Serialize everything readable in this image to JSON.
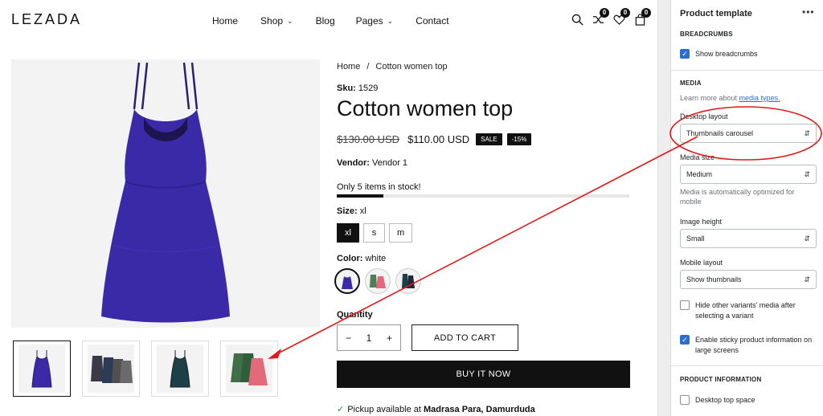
{
  "store": {
    "logo": "LEZADA",
    "nav": [
      {
        "label": "Home",
        "has_dropdown": false
      },
      {
        "label": "Shop",
        "has_dropdown": true
      },
      {
        "label": "Blog",
        "has_dropdown": false
      },
      {
        "label": "Pages",
        "has_dropdown": true
      },
      {
        "label": "Contact",
        "has_dropdown": false
      }
    ],
    "header_icons": [
      {
        "name": "search-icon"
      },
      {
        "name": "compare-icon",
        "count": "0"
      },
      {
        "name": "wishlist-icon",
        "count": "0"
      },
      {
        "name": "cart-icon",
        "count": "0"
      }
    ],
    "breadcrumb": {
      "home": "Home",
      "sep": "/",
      "current": "Cotton women top"
    },
    "sku": {
      "label": "Sku:",
      "value": "1529"
    },
    "title": "Cotton women top",
    "price": {
      "old": "$130.00 USD",
      "new": "$110.00 USD",
      "sale_tag": "SALE",
      "discount_tag": "-15%"
    },
    "vendor": {
      "label": "Vendor:",
      "value": "Vendor 1"
    },
    "stock": {
      "text": "Only 5 items in stock!",
      "level": 0.16
    },
    "size": {
      "label": "Size:",
      "value": "xl",
      "options": [
        "xl",
        "s",
        "m"
      ],
      "selected": 0
    },
    "color": {
      "label": "Color:",
      "value": "white",
      "swatch_colors": [
        "#3b2aa8",
        "#5a8a5f",
        "#1d3f48"
      ],
      "selected": 0
    },
    "quantity": {
      "label": "Quantity",
      "value": "1",
      "minus": "−",
      "plus": "+"
    },
    "add_to_cart": "ADD TO CART",
    "buy_now": "BUY IT NOW",
    "pickup": {
      "text": "Pickup available at ",
      "location": "Madrasa Para, Damurduda"
    },
    "colors": {
      "top_purple": "#3b2aa8",
      "dark": "#111111"
    }
  },
  "panel": {
    "title": "Product template",
    "more": "•••",
    "breadcrumbs_heading": "BREADCRUMBS",
    "show_breadcrumbs": {
      "label": "Show breadcrumbs",
      "checked": true
    },
    "media_heading": "MEDIA",
    "media_help_prefix": "Learn more about ",
    "media_help_link": "media types.",
    "desktop_layout": {
      "label": "Desktop layout",
      "value": "Thumbnails carousel"
    },
    "media_size": {
      "label": "Media size",
      "value": "Medium",
      "help": "Media is automatically optimized for mobile"
    },
    "image_height": {
      "label": "Image height",
      "value": "Small"
    },
    "mobile_layout": {
      "label": "Mobile layout",
      "value": "Show thumbnails"
    },
    "hide_variants": {
      "label": "Hide other variants' media after selecting a variant",
      "checked": false
    },
    "sticky_info": {
      "label": "Enable sticky product information on large screens",
      "checked": true
    },
    "product_info_heading": "PRODUCT INFORMATION",
    "desktop_top_space": {
      "label": "Desktop top space",
      "checked": false
    },
    "accent": "#2c6ecb"
  },
  "annotation": {
    "color": "#e11919"
  }
}
